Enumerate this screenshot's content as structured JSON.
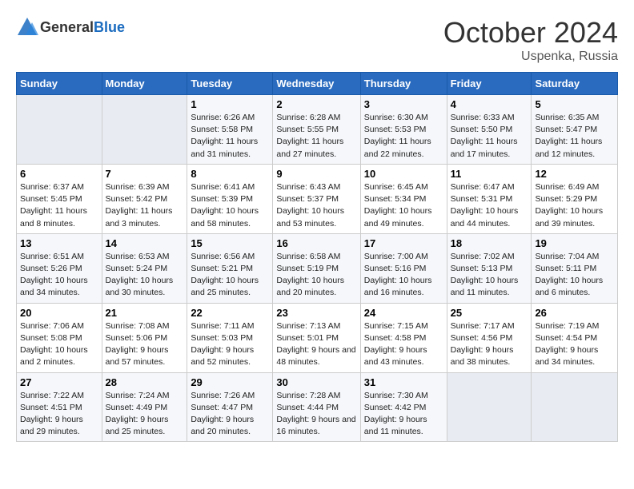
{
  "header": {
    "logo_general": "General",
    "logo_blue": "Blue",
    "month": "October 2024",
    "location": "Uspenka, Russia"
  },
  "weekdays": [
    "Sunday",
    "Monday",
    "Tuesday",
    "Wednesday",
    "Thursday",
    "Friday",
    "Saturday"
  ],
  "weeks": [
    [
      {
        "num": "",
        "info": ""
      },
      {
        "num": "",
        "info": ""
      },
      {
        "num": "1",
        "info": "Sunrise: 6:26 AM\nSunset: 5:58 PM\nDaylight: 11 hours and 31 minutes."
      },
      {
        "num": "2",
        "info": "Sunrise: 6:28 AM\nSunset: 5:55 PM\nDaylight: 11 hours and 27 minutes."
      },
      {
        "num": "3",
        "info": "Sunrise: 6:30 AM\nSunset: 5:53 PM\nDaylight: 11 hours and 22 minutes."
      },
      {
        "num": "4",
        "info": "Sunrise: 6:33 AM\nSunset: 5:50 PM\nDaylight: 11 hours and 17 minutes."
      },
      {
        "num": "5",
        "info": "Sunrise: 6:35 AM\nSunset: 5:47 PM\nDaylight: 11 hours and 12 minutes."
      }
    ],
    [
      {
        "num": "6",
        "info": "Sunrise: 6:37 AM\nSunset: 5:45 PM\nDaylight: 11 hours and 8 minutes."
      },
      {
        "num": "7",
        "info": "Sunrise: 6:39 AM\nSunset: 5:42 PM\nDaylight: 11 hours and 3 minutes."
      },
      {
        "num": "8",
        "info": "Sunrise: 6:41 AM\nSunset: 5:39 PM\nDaylight: 10 hours and 58 minutes."
      },
      {
        "num": "9",
        "info": "Sunrise: 6:43 AM\nSunset: 5:37 PM\nDaylight: 10 hours and 53 minutes."
      },
      {
        "num": "10",
        "info": "Sunrise: 6:45 AM\nSunset: 5:34 PM\nDaylight: 10 hours and 49 minutes."
      },
      {
        "num": "11",
        "info": "Sunrise: 6:47 AM\nSunset: 5:31 PM\nDaylight: 10 hours and 44 minutes."
      },
      {
        "num": "12",
        "info": "Sunrise: 6:49 AM\nSunset: 5:29 PM\nDaylight: 10 hours and 39 minutes."
      }
    ],
    [
      {
        "num": "13",
        "info": "Sunrise: 6:51 AM\nSunset: 5:26 PM\nDaylight: 10 hours and 34 minutes."
      },
      {
        "num": "14",
        "info": "Sunrise: 6:53 AM\nSunset: 5:24 PM\nDaylight: 10 hours and 30 minutes."
      },
      {
        "num": "15",
        "info": "Sunrise: 6:56 AM\nSunset: 5:21 PM\nDaylight: 10 hours and 25 minutes."
      },
      {
        "num": "16",
        "info": "Sunrise: 6:58 AM\nSunset: 5:19 PM\nDaylight: 10 hours and 20 minutes."
      },
      {
        "num": "17",
        "info": "Sunrise: 7:00 AM\nSunset: 5:16 PM\nDaylight: 10 hours and 16 minutes."
      },
      {
        "num": "18",
        "info": "Sunrise: 7:02 AM\nSunset: 5:13 PM\nDaylight: 10 hours and 11 minutes."
      },
      {
        "num": "19",
        "info": "Sunrise: 7:04 AM\nSunset: 5:11 PM\nDaylight: 10 hours and 6 minutes."
      }
    ],
    [
      {
        "num": "20",
        "info": "Sunrise: 7:06 AM\nSunset: 5:08 PM\nDaylight: 10 hours and 2 minutes."
      },
      {
        "num": "21",
        "info": "Sunrise: 7:08 AM\nSunset: 5:06 PM\nDaylight: 9 hours and 57 minutes."
      },
      {
        "num": "22",
        "info": "Sunrise: 7:11 AM\nSunset: 5:03 PM\nDaylight: 9 hours and 52 minutes."
      },
      {
        "num": "23",
        "info": "Sunrise: 7:13 AM\nSunset: 5:01 PM\nDaylight: 9 hours and 48 minutes."
      },
      {
        "num": "24",
        "info": "Sunrise: 7:15 AM\nSunset: 4:58 PM\nDaylight: 9 hours and 43 minutes."
      },
      {
        "num": "25",
        "info": "Sunrise: 7:17 AM\nSunset: 4:56 PM\nDaylight: 9 hours and 38 minutes."
      },
      {
        "num": "26",
        "info": "Sunrise: 7:19 AM\nSunset: 4:54 PM\nDaylight: 9 hours and 34 minutes."
      }
    ],
    [
      {
        "num": "27",
        "info": "Sunrise: 7:22 AM\nSunset: 4:51 PM\nDaylight: 9 hours and 29 minutes."
      },
      {
        "num": "28",
        "info": "Sunrise: 7:24 AM\nSunset: 4:49 PM\nDaylight: 9 hours and 25 minutes."
      },
      {
        "num": "29",
        "info": "Sunrise: 7:26 AM\nSunset: 4:47 PM\nDaylight: 9 hours and 20 minutes."
      },
      {
        "num": "30",
        "info": "Sunrise: 7:28 AM\nSunset: 4:44 PM\nDaylight: 9 hours and 16 minutes."
      },
      {
        "num": "31",
        "info": "Sunrise: 7:30 AM\nSunset: 4:42 PM\nDaylight: 9 hours and 11 minutes."
      },
      {
        "num": "",
        "info": ""
      },
      {
        "num": "",
        "info": ""
      }
    ]
  ]
}
